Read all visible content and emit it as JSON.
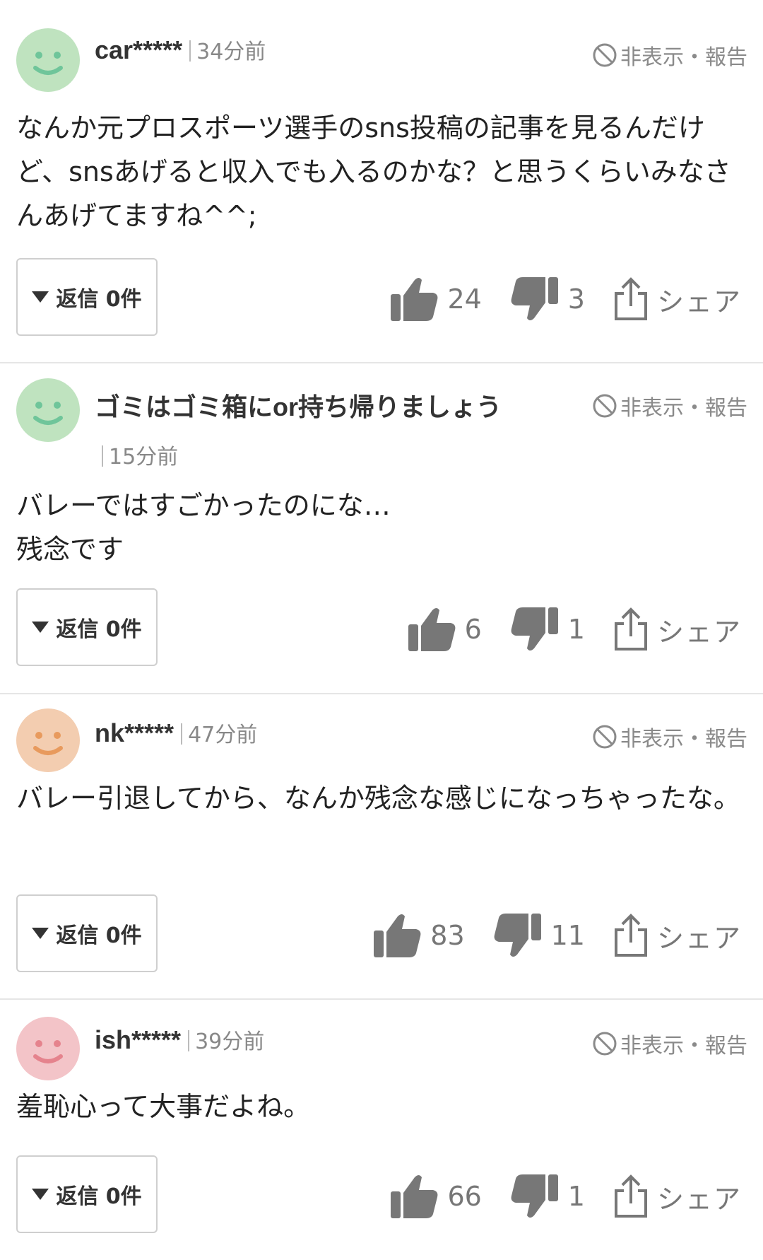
{
  "hide_report_label": "非表示・報告",
  "reply_label": "返信 0件",
  "share_label": "シェア",
  "comments": [
    {
      "username": "car*****",
      "time": "34分前",
      "avatar_color": "#bfe3bf",
      "face_color": "#6fc59a",
      "text": "なんか元プロスポーツ選手のsns投稿の記事を見るんだけど、snsあげると収入でも入るのかな？と思うくらいみなさんあげてますね^^;",
      "likes": "24",
      "dislikes": "3"
    },
    {
      "username": "ゴミはゴミ箱にor持ち帰りましょう",
      "time": "15分前",
      "avatar_color": "#bfe3bf",
      "face_color": "#6fc59a",
      "text": "バレーではすごかったのにな…\n残念です",
      "likes": "6",
      "dislikes": "1"
    },
    {
      "username": "nk*****",
      "time": "47分前",
      "avatar_color": "#f3cdb0",
      "face_color": "#e89a5d",
      "text": "バレー引退してから、なんか残念な感じになっちゃったな。",
      "likes": "83",
      "dislikes": "11"
    },
    {
      "username": "ish*****",
      "time": "39分前",
      "avatar_color": "#f3c4c8",
      "face_color": "#e5838d",
      "text": "羞恥心って大事だよね。",
      "likes": "66",
      "dislikes": "1"
    }
  ]
}
